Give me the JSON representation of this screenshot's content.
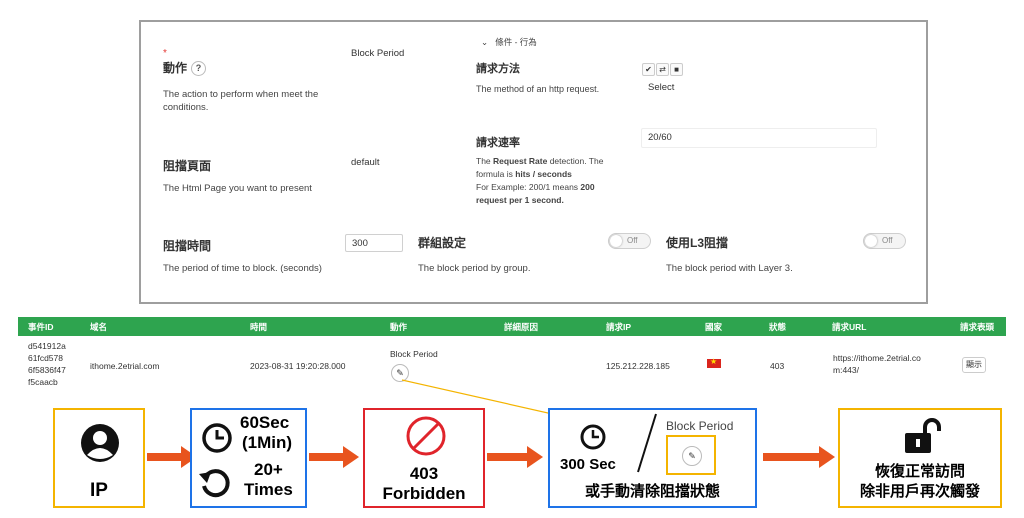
{
  "settings": {
    "required_mark": "*",
    "action": {
      "label": "動作",
      "help": "?",
      "description": "The action to perform when meet the conditions.",
      "value": "Block Period"
    },
    "block_page": {
      "label": "阻擋頁面",
      "description": "The Html Page you want to present",
      "value": "default"
    },
    "block_time": {
      "label": "阻擋時間",
      "description": "The period of time to block. (seconds)",
      "value": "300"
    },
    "conditions_toggle": "⌄",
    "conditions_title": "條件 - 行為",
    "request_method": {
      "label": "請求方法",
      "description": "The method of an http request.",
      "value": "Select"
    },
    "request_rate": {
      "label": "請求速率",
      "value": "20/60",
      "desc_1": "The ",
      "desc_bold_1": "Request Rate",
      "desc_2": " detection. The formula is ",
      "desc_bold_2": "hits / seconds",
      "desc_3": "For Example: 200/1 means ",
      "desc_bold_3": "200 request per 1 second."
    },
    "group_setting": {
      "label": "群組設定",
      "description": "The block period by group.",
      "toggle": "Off"
    },
    "l3_block": {
      "label": "使用L3阻擋",
      "description": "The block period with Layer 3.",
      "toggle": "Off"
    }
  },
  "table": {
    "headers": [
      "事件ID",
      "域名",
      "時間",
      "動作",
      "詳細原因",
      "請求IP",
      "國家",
      "狀態",
      "請求URL",
      "請求表頭"
    ],
    "row": {
      "event_id": [
        "d541912a",
        "61fcd578",
        "6f5836f47",
        "f5caacb"
      ],
      "domain": "ithome.2etrial.com",
      "time": "2023-08-31 19:20:28.000",
      "action": "Block Period",
      "ip": "125.212.228.185",
      "status": "403",
      "url": [
        "https://ithome.2etrial.co",
        "m:443/"
      ],
      "headers_button": "顯示"
    }
  },
  "flow": {
    "ip_label": "IP",
    "rate_seconds": "60Sec",
    "rate_minutes": "(1Min)",
    "rate_count": "20+",
    "rate_times": "Times",
    "forbidden_code": "403",
    "forbidden_text": "Forbidden",
    "block_seconds": "300 Sec",
    "block_action": "Block Period",
    "manual_clear": "或手動清除阻擋狀態",
    "restore_1": "恢復正常訪問",
    "restore_2": "除非用戶再次觸發"
  },
  "colors": {
    "table_header": "#2ea44f",
    "arrow": "#e8541e",
    "box_yellow": "#f4b400",
    "box_blue": "#1e73e8",
    "box_red": "#e0242b"
  }
}
